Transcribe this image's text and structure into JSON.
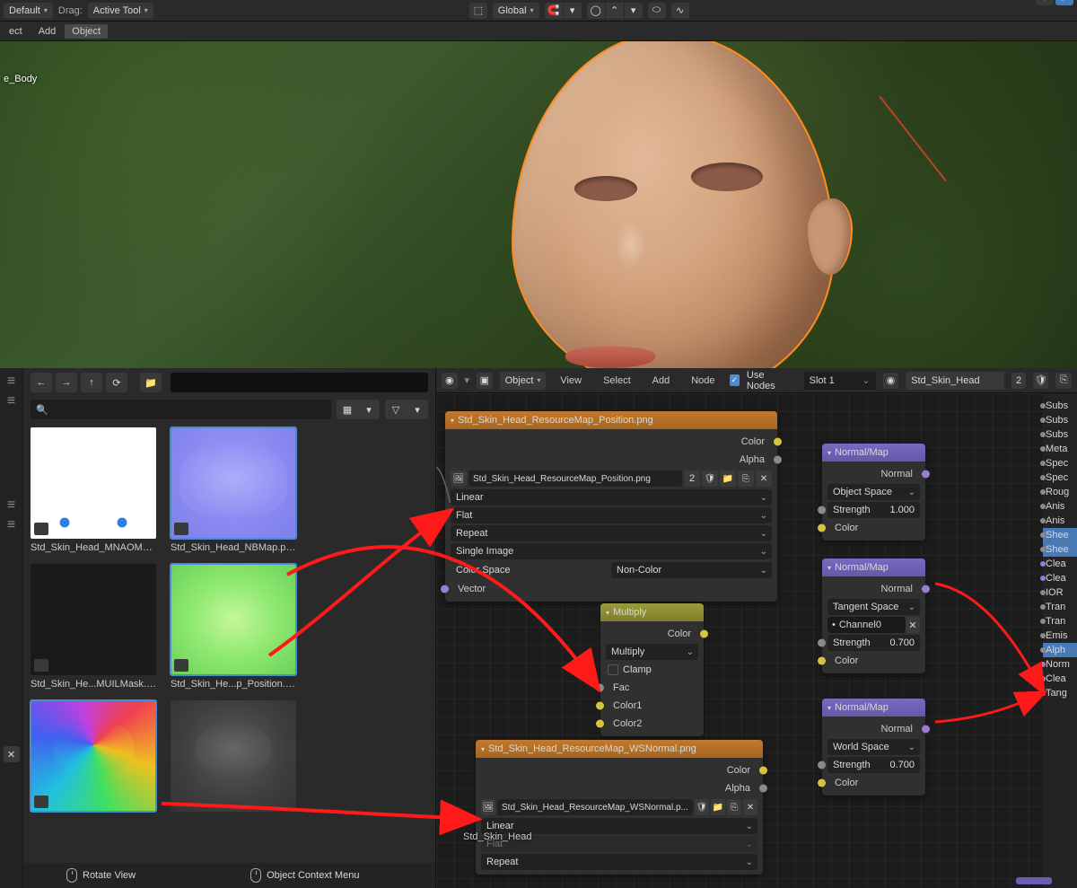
{
  "top_toolbar": {
    "mode_select": "Default",
    "drag_label": "Drag:",
    "drag_select": "Active Tool",
    "orientation": "Global"
  },
  "menu": {
    "items": [
      "ect",
      "Add",
      "Object"
    ]
  },
  "viewport": {
    "object_name": "e_Body"
  },
  "file_browser": {
    "search_placeholder": "",
    "thumbs": [
      {
        "label": "Std_Skin_Head_MNAOMas..."
      },
      {
        "label": "Std_Skin_Head_NBMap.png"
      },
      {
        "label": "Std_Skin_He...MUILMask.pn"
      },
      {
        "label": "Std_Skin_He...p_Position.png"
      },
      {
        "label": ""
      },
      {
        "label": ""
      }
    ],
    "status_left": "Rotate View",
    "status_right": "Object Context Menu"
  },
  "node_editor": {
    "header": {
      "mode": "Object",
      "menus": [
        "View",
        "Select",
        "Add",
        "Node"
      ],
      "use_nodes_label": "Use Nodes",
      "slot": "Slot 1",
      "material": "Std_Skin_Head",
      "users": "2"
    },
    "tex_node_1": {
      "title": "Std_Skin_Head_ResourceMap_Position.png",
      "outputs": {
        "color": "Color",
        "alpha": "Alpha"
      },
      "image": "Std_Skin_Head_ResourceMap_Position.png",
      "image_users": "2",
      "interp": "Linear",
      "projection": "Flat",
      "extension": "Repeat",
      "source": "Single Image",
      "colorspace_label": "Color Space",
      "colorspace": "Non-Color",
      "input_vector": "Vector"
    },
    "multiply_node": {
      "title": "Multiply",
      "out_color": "Color",
      "blend": "Multiply",
      "clamp": "Clamp",
      "fac": "Fac",
      "c1": "Color1",
      "c2": "Color2"
    },
    "tex_node_2": {
      "title": "Std_Skin_Head_ResourceMap_WSNormal.png",
      "outputs": {
        "color": "Color",
        "alpha": "Alpha"
      },
      "image": "Std_Skin_Head_ResourceMap_WSNormal.p...",
      "interp": "Linear",
      "projection": "Flat",
      "extension": "Repeat"
    },
    "normal_nodes": [
      {
        "title": "Normal/Map",
        "out": "Normal",
        "space": "Object Space",
        "strength_lbl": "Strength",
        "strength": "1.000",
        "color_in": "Color"
      },
      {
        "title": "Normal/Map",
        "out": "Normal",
        "space": "Tangent Space",
        "uvmap": "Channel0",
        "strength_lbl": "Strength",
        "strength": "0.700",
        "color_in": "Color"
      },
      {
        "title": "Normal/Map",
        "out": "Normal",
        "space": "World Space",
        "strength_lbl": "Strength",
        "strength": "0.700",
        "color_in": "Color"
      }
    ],
    "output_props": [
      "Subs",
      "Subs",
      "Subs",
      "Meta",
      "Spec",
      "Spec",
      "Roug",
      "Anis",
      "Anis",
      "Shee",
      "Shee",
      "Clea",
      "Clea",
      "IOR",
      "Tran",
      "Tran",
      "Emis",
      "Alph",
      "Norm",
      "Clea",
      "Tang"
    ],
    "active_props": [
      "Shee",
      "Alph"
    ],
    "floating_label": "Std_Skin_Head"
  }
}
